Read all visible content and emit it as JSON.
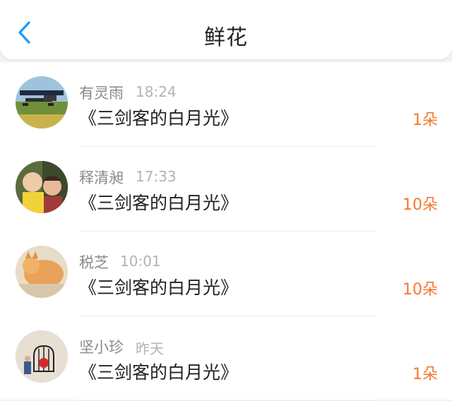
{
  "header": {
    "title": "鲜花",
    "back_icon": "chevron-left-icon",
    "accent_color": "#1b9af7"
  },
  "items": [
    {
      "name": "有灵雨",
      "time": "18:24",
      "desc": "《三剑客的白月光》",
      "count": "1朵"
    },
    {
      "name": "释清昶",
      "time": "17:33",
      "desc": "《三剑客的白月光》",
      "count": "10朵"
    },
    {
      "name": "税芝",
      "time": "10:01",
      "desc": "《三剑客的白月光》",
      "count": "10朵"
    },
    {
      "name": "坚小珍",
      "time": "昨天",
      "desc": "《三剑客的白月光》",
      "count": "1朵"
    }
  ],
  "colors": {
    "count": "#f4782e",
    "name": "#8a8a8a",
    "time": "#b3b3b3"
  }
}
